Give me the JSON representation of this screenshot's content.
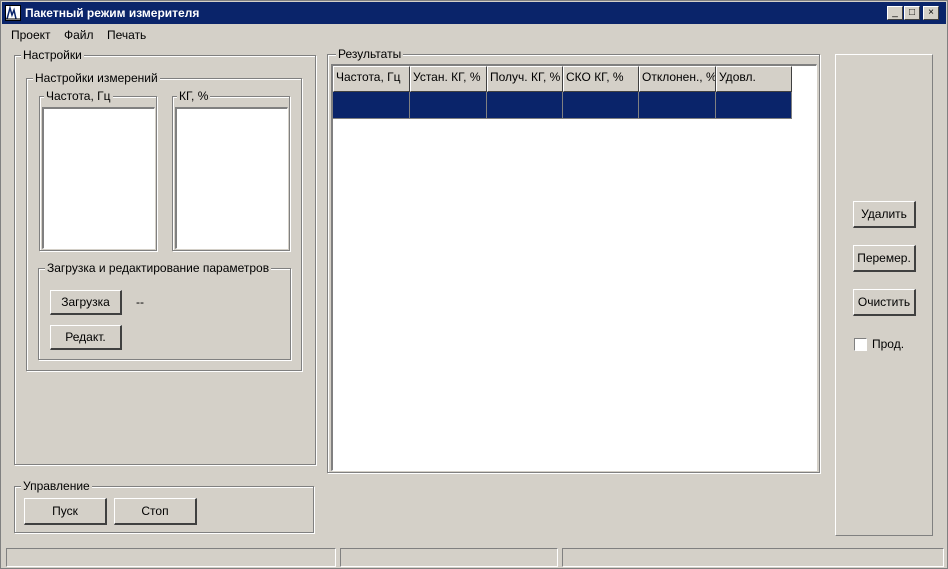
{
  "window": {
    "title": "Пакетный режим измерителя",
    "controls": [
      "_",
      "□",
      "×"
    ]
  },
  "menu": [
    "Проект",
    "Файл",
    "Печать"
  ],
  "settings": {
    "title": "Настройки",
    "measure": {
      "title": "Настройки измерений",
      "freq_label": "Частота, Гц",
      "kg_label": "КГ, %"
    },
    "params": {
      "title": "Загрузка и редактирование параметров",
      "load_button": "Загрузка",
      "load_value": "--",
      "edit_button": "Редакт."
    }
  },
  "control": {
    "title": "Управление",
    "start_button": "Пуск",
    "stop_button": "Стоп"
  },
  "results": {
    "title": "Результаты",
    "columns": [
      "Частота, Гц",
      "Устан. КГ, %",
      "Получ. КГ, %",
      "СКО КГ, %",
      "Отклонен., %",
      "Удовл."
    ]
  },
  "actions": {
    "delete_button": "Удалить",
    "remeasure_button": "Перемер.",
    "clear_button": "Очистить",
    "continue_label": "Прод."
  },
  "colors": {
    "title_bar": "#0a246a",
    "selection": "#0a246a",
    "face": "#d4d0c8"
  }
}
